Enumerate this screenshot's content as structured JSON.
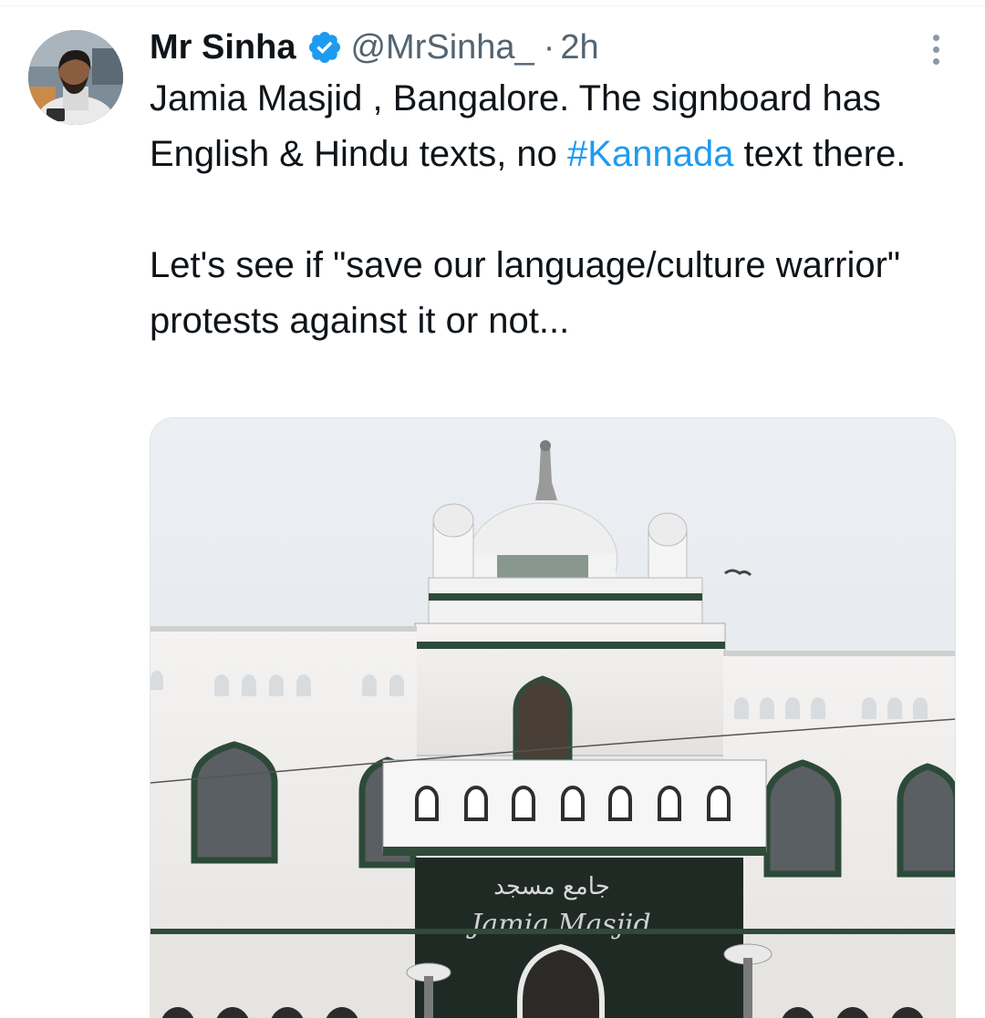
{
  "tweet": {
    "author": {
      "display_name": "Mr Sinha",
      "handle": "@MrSinha_",
      "verified": true,
      "verified_color": "#1d9bf0"
    },
    "separator": "·",
    "timestamp": "2h",
    "text": {
      "line1_part1": "Jamia Masjid , Bangalore. The signboard has English & Hindu texts, no ",
      "hashtag": "#Kannada",
      "line1_part2": " text there.",
      "paragraph2": "Let's see if \"save our language/culture warrior\" protests against it or not..."
    },
    "media": {
      "signboard_text": "Jamia Masjid",
      "signboard_arabic": "جامع مسجد"
    },
    "icons": {
      "more": "more-vertical-icon",
      "verified": "verified-badge-icon"
    },
    "colors": {
      "text": "#0f1419",
      "secondary": "#536471",
      "link": "#1d9bf0"
    }
  }
}
